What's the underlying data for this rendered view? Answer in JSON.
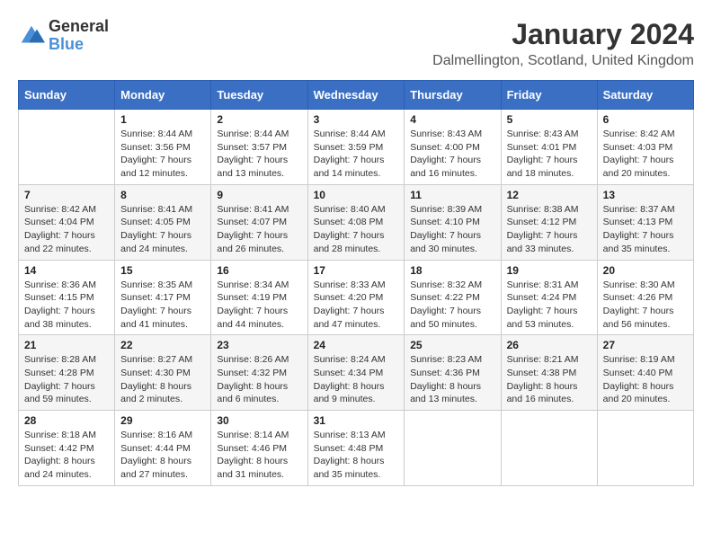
{
  "logo": {
    "text_general": "General",
    "text_blue": "Blue"
  },
  "title": "January 2024",
  "subtitle": "Dalmellington, Scotland, United Kingdom",
  "days_of_week": [
    "Sunday",
    "Monday",
    "Tuesday",
    "Wednesday",
    "Thursday",
    "Friday",
    "Saturday"
  ],
  "weeks": [
    [
      {
        "day": "",
        "info": ""
      },
      {
        "day": "1",
        "info": "Sunrise: 8:44 AM\nSunset: 3:56 PM\nDaylight: 7 hours\nand 12 minutes."
      },
      {
        "day": "2",
        "info": "Sunrise: 8:44 AM\nSunset: 3:57 PM\nDaylight: 7 hours\nand 13 minutes."
      },
      {
        "day": "3",
        "info": "Sunrise: 8:44 AM\nSunset: 3:59 PM\nDaylight: 7 hours\nand 14 minutes."
      },
      {
        "day": "4",
        "info": "Sunrise: 8:43 AM\nSunset: 4:00 PM\nDaylight: 7 hours\nand 16 minutes."
      },
      {
        "day": "5",
        "info": "Sunrise: 8:43 AM\nSunset: 4:01 PM\nDaylight: 7 hours\nand 18 minutes."
      },
      {
        "day": "6",
        "info": "Sunrise: 8:42 AM\nSunset: 4:03 PM\nDaylight: 7 hours\nand 20 minutes."
      }
    ],
    [
      {
        "day": "7",
        "info": "Sunrise: 8:42 AM\nSunset: 4:04 PM\nDaylight: 7 hours\nand 22 minutes."
      },
      {
        "day": "8",
        "info": "Sunrise: 8:41 AM\nSunset: 4:05 PM\nDaylight: 7 hours\nand 24 minutes."
      },
      {
        "day": "9",
        "info": "Sunrise: 8:41 AM\nSunset: 4:07 PM\nDaylight: 7 hours\nand 26 minutes."
      },
      {
        "day": "10",
        "info": "Sunrise: 8:40 AM\nSunset: 4:08 PM\nDaylight: 7 hours\nand 28 minutes."
      },
      {
        "day": "11",
        "info": "Sunrise: 8:39 AM\nSunset: 4:10 PM\nDaylight: 7 hours\nand 30 minutes."
      },
      {
        "day": "12",
        "info": "Sunrise: 8:38 AM\nSunset: 4:12 PM\nDaylight: 7 hours\nand 33 minutes."
      },
      {
        "day": "13",
        "info": "Sunrise: 8:37 AM\nSunset: 4:13 PM\nDaylight: 7 hours\nand 35 minutes."
      }
    ],
    [
      {
        "day": "14",
        "info": "Sunrise: 8:36 AM\nSunset: 4:15 PM\nDaylight: 7 hours\nand 38 minutes."
      },
      {
        "day": "15",
        "info": "Sunrise: 8:35 AM\nSunset: 4:17 PM\nDaylight: 7 hours\nand 41 minutes."
      },
      {
        "day": "16",
        "info": "Sunrise: 8:34 AM\nSunset: 4:19 PM\nDaylight: 7 hours\nand 44 minutes."
      },
      {
        "day": "17",
        "info": "Sunrise: 8:33 AM\nSunset: 4:20 PM\nDaylight: 7 hours\nand 47 minutes."
      },
      {
        "day": "18",
        "info": "Sunrise: 8:32 AM\nSunset: 4:22 PM\nDaylight: 7 hours\nand 50 minutes."
      },
      {
        "day": "19",
        "info": "Sunrise: 8:31 AM\nSunset: 4:24 PM\nDaylight: 7 hours\nand 53 minutes."
      },
      {
        "day": "20",
        "info": "Sunrise: 8:30 AM\nSunset: 4:26 PM\nDaylight: 7 hours\nand 56 minutes."
      }
    ],
    [
      {
        "day": "21",
        "info": "Sunrise: 8:28 AM\nSunset: 4:28 PM\nDaylight: 7 hours\nand 59 minutes."
      },
      {
        "day": "22",
        "info": "Sunrise: 8:27 AM\nSunset: 4:30 PM\nDaylight: 8 hours\nand 2 minutes."
      },
      {
        "day": "23",
        "info": "Sunrise: 8:26 AM\nSunset: 4:32 PM\nDaylight: 8 hours\nand 6 minutes."
      },
      {
        "day": "24",
        "info": "Sunrise: 8:24 AM\nSunset: 4:34 PM\nDaylight: 8 hours\nand 9 minutes."
      },
      {
        "day": "25",
        "info": "Sunrise: 8:23 AM\nSunset: 4:36 PM\nDaylight: 8 hours\nand 13 minutes."
      },
      {
        "day": "26",
        "info": "Sunrise: 8:21 AM\nSunset: 4:38 PM\nDaylight: 8 hours\nand 16 minutes."
      },
      {
        "day": "27",
        "info": "Sunrise: 8:19 AM\nSunset: 4:40 PM\nDaylight: 8 hours\nand 20 minutes."
      }
    ],
    [
      {
        "day": "28",
        "info": "Sunrise: 8:18 AM\nSunset: 4:42 PM\nDaylight: 8 hours\nand 24 minutes."
      },
      {
        "day": "29",
        "info": "Sunrise: 8:16 AM\nSunset: 4:44 PM\nDaylight: 8 hours\nand 27 minutes."
      },
      {
        "day": "30",
        "info": "Sunrise: 8:14 AM\nSunset: 4:46 PM\nDaylight: 8 hours\nand 31 minutes."
      },
      {
        "day": "31",
        "info": "Sunrise: 8:13 AM\nSunset: 4:48 PM\nDaylight: 8 hours\nand 35 minutes."
      },
      {
        "day": "",
        "info": ""
      },
      {
        "day": "",
        "info": ""
      },
      {
        "day": "",
        "info": ""
      }
    ]
  ]
}
